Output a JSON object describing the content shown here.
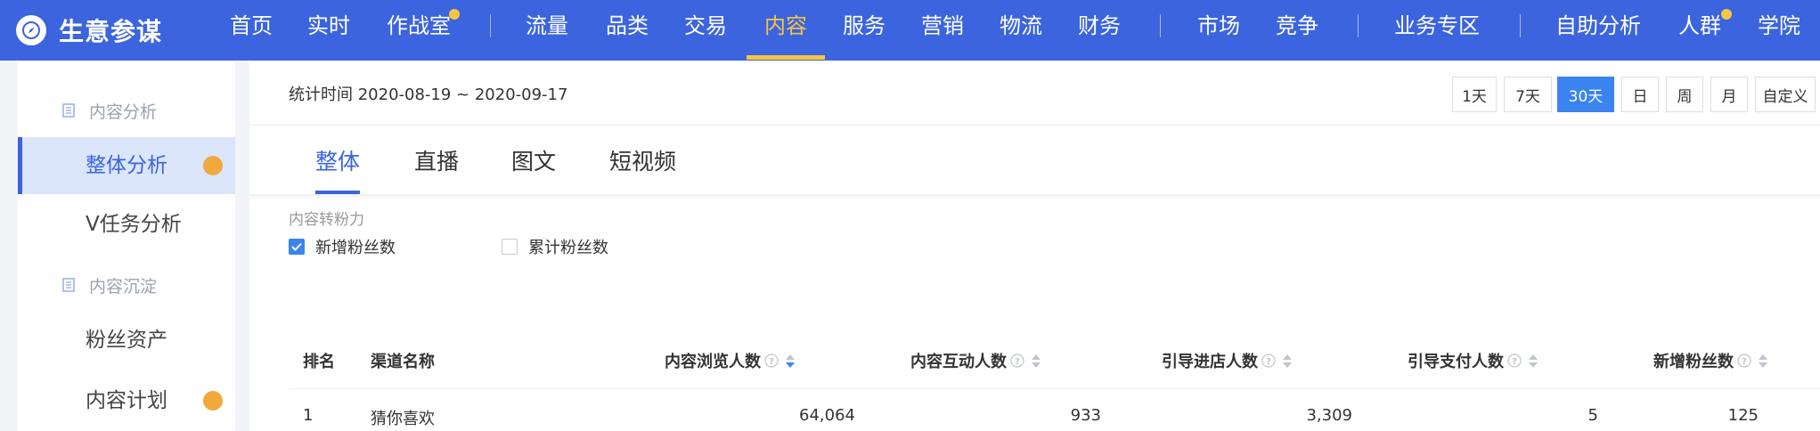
{
  "brand": {
    "title": "生意参谋"
  },
  "nav": {
    "items": [
      "首页",
      "实时",
      "作战室",
      "流量",
      "品类",
      "交易",
      "内容",
      "服务",
      "营销",
      "物流",
      "财务",
      "市场",
      "竞争",
      "业务专区",
      "自助分析",
      "人群",
      "学院"
    ],
    "active": "内容"
  },
  "sidebar": {
    "group1": "内容分析",
    "item_overall": "整体分析",
    "item_vtask": "V任务分析",
    "group2": "内容沉淀",
    "item_fans": "粉丝资产",
    "item_plan": "内容计划"
  },
  "header": {
    "stat_time": "统计时间 2020-08-19 ~ 2020-09-17",
    "ranges": [
      "1天",
      "7天",
      "30天",
      "日",
      "周",
      "月",
      "自定义"
    ],
    "active_range": "30天"
  },
  "tabs": [
    "整体",
    "直播",
    "图文",
    "短视频"
  ],
  "conversion": {
    "label": "内容转粉力",
    "opt_new": "新增粉丝数",
    "opt_total": "累计粉丝数"
  },
  "table": {
    "headers": [
      "排名",
      "渠道名称",
      "内容浏览人数",
      "内容互动人数",
      "引导进店人数",
      "引导支付人数",
      "新增粉丝数"
    ],
    "rows": [
      {
        "rank": "1",
        "channel": "猜你喜欢",
        "views": "64,064",
        "interactions": "933",
        "store_visits": "3,309",
        "payments": "5",
        "new_fans": "125"
      }
    ]
  },
  "colors": {
    "nav_bg": "#3b64de",
    "accent": "#f6c544",
    "primary": "#3b84f0",
    "badge": "#f1a93c"
  }
}
